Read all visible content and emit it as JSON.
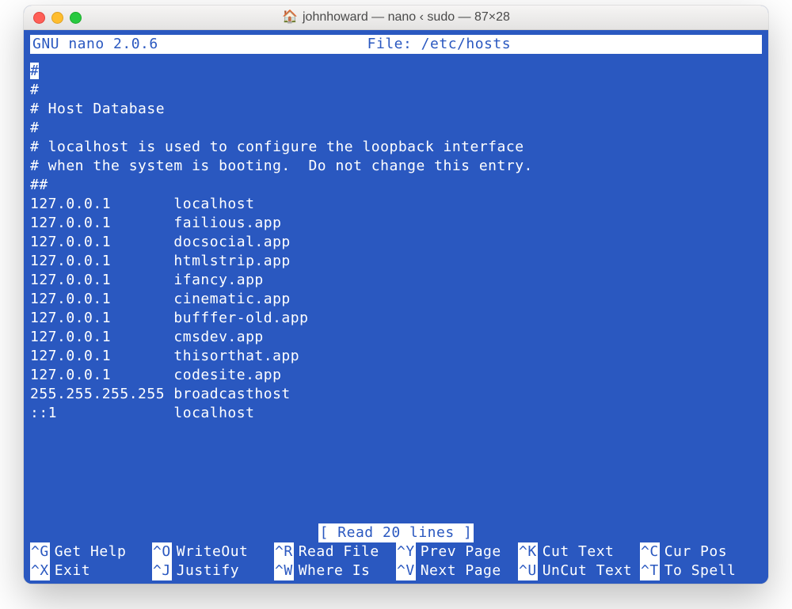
{
  "window": {
    "title": "johnhoward — nano ‹ sudo — 87×28"
  },
  "header": {
    "app": "GNU nano 2.0.6",
    "file_label": "File: /etc/hosts"
  },
  "content_lines": [
    "#",
    "#",
    "# Host Database",
    "#",
    "# localhost is used to configure the loopback interface",
    "# when the system is booting.  Do not change this entry.",
    "##",
    "127.0.0.1       localhost",
    "127.0.0.1       failious.app",
    "127.0.0.1       docsocial.app",
    "127.0.0.1       htmlstrip.app",
    "127.0.0.1       ifancy.app",
    "127.0.0.1       cinematic.app",
    "127.0.0.1       bufffer-old.app",
    "127.0.0.1       cmsdev.app",
    "127.0.0.1       thisorthat.app",
    "127.0.0.1       codesite.app",
    "255.255.255.255 broadcasthost",
    "::1             localhost"
  ],
  "cursor_line_index": 0,
  "status": "[ Read 20 lines ]",
  "shortcuts": [
    {
      "key": "^G",
      "label": "Get Help"
    },
    {
      "key": "^O",
      "label": "WriteOut"
    },
    {
      "key": "^R",
      "label": "Read File"
    },
    {
      "key": "^Y",
      "label": "Prev Page"
    },
    {
      "key": "^K",
      "label": "Cut Text"
    },
    {
      "key": "^C",
      "label": "Cur Pos"
    },
    {
      "key": "^X",
      "label": "Exit"
    },
    {
      "key": "^J",
      "label": "Justify"
    },
    {
      "key": "^W",
      "label": "Where Is"
    },
    {
      "key": "^V",
      "label": "Next Page"
    },
    {
      "key": "^U",
      "label": "UnCut Text"
    },
    {
      "key": "^T",
      "label": "To Spell"
    }
  ]
}
